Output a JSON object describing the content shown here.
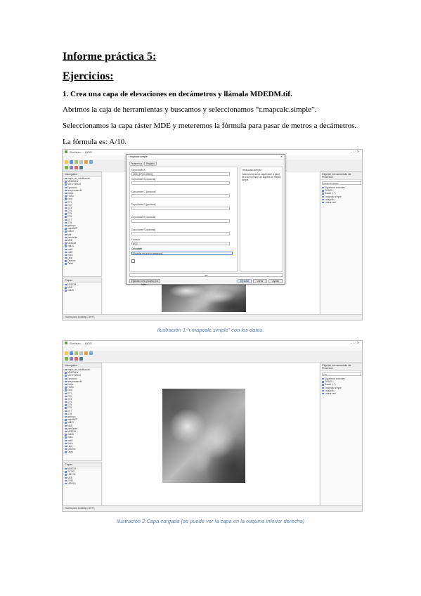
{
  "heading1": "Informe práctica 5:",
  "heading2": "Ejercicios:",
  "question": "1.   Crea una capa de elevaciones en decámetros y llámala MDEDM.tif.",
  "para1": "Abrimos la caja de herramientas y buscamos y seleccionamos “r.mapcalc.simple”.",
  "para2": "Seleccionamos la capa ráster MDE y meteremos la fórmula para pasar de metros a decámetros.",
  "para3": "La fórmula es: A/10.",
  "caption1": "Ilustración 1:“r.mapcalc.simple” con los datos.",
  "caption2": "Ilustración 2:Capa cargada (se puede ver la capa en la esquina inferior derecha)",
  "shot1": {
    "title": "Sin título — QGIS",
    "browser_title": "Navegador",
    "layers_title": "Capas",
    "toolbox_title": "Caja de herramientas de Procesos",
    "browser_items": [
      "mapa_de_clasificación",
      "MDEDM.tif",
      "MDT2.00B.tif",
      "Ejecución",
      "temperatura.tif",
      "Datos",
      "FGBD",
      "zona",
      "GT1",
      "GT2",
      "GT3",
      "GT4",
      "GT5",
      "GT6",
      "GT7",
      "GT8",
      "geotopo",
      "mapaMDT",
      "Mdt23",
      "Mdt",
      "pendiente",
      "MDE",
      "MDEDM",
      "mdt25",
      "mdt6",
      "mdt8",
      "Hidro",
      "Lidar",
      "Ortofoto",
      "Tarea"
    ],
    "layer_items": [
      "MDEDM",
      "MDE",
      "mdt25"
    ],
    "toolbox_items": [
      "r.mapcalc.simple",
      "Algoritmos recientes",
      "GRASS",
      "Raster (r.*)",
      "r.mapcalc.simple",
      "r.mapcalc",
      "r.mask.rast"
    ],
    "statusbar": "Escriba para localizar (Ctrl+K)",
    "dialog": {
      "title": "r.mapcalc.simple",
      "tabs": [
        "Parámetros",
        "Registro"
      ],
      "labels": [
        "Capa ráster A",
        "Capa ráster B [opcional]",
        "Capa ráster C [opcional]",
        "Capa ráster D [opcional]",
        "Capa ráster E [opcional]",
        "Capa ráster F [opcional]",
        "Fórmula",
        "Calculado"
      ],
      "selected": "MDE [EPSG:25830]",
      "formula": "A/10",
      "output": "[Guardar en archivo temporal]",
      "help_title": "r.mapcalc.simple",
      "help_text": "Calcula una nueva capa ráster a partir de una expresión de álgebra de mapas simple.",
      "progress": "0%",
      "buttons": [
        "Ejecutar como proceso por lotes...",
        "Ejecutar",
        "Cerrar",
        "Ayuda"
      ]
    }
  },
  "shot2": {
    "title": "Sin título — QGIS",
    "browser_title": "Navegador",
    "layers_title": "Capas",
    "toolbox_title": "Caja de herramientas de Procesos",
    "browser_items": [
      "mapa_de_clasificación",
      "MDEDM.tif",
      "MDT2.00B.tif",
      "Ejecución",
      "temperatura.tif",
      "Datos",
      "FGBD",
      "zona",
      "GT1",
      "GT2",
      "GT3",
      "GT4",
      "GT5",
      "GT6",
      "GT7",
      "GT8",
      "geotopo",
      "mapaMDT",
      "Mdt23",
      "MDE",
      "pendiente",
      "MDEDM",
      "mdt25",
      "mdt6",
      "mdt8",
      "Hidro",
      "Lidar",
      "Ortofoto",
      "Tarea"
    ],
    "layer_items": [
      "MDEDM",
      "24.789",
      "1560.96",
      "MDE",
      "2.890",
      "15609.6"
    ],
    "toolbox_items": [
      "calc",
      "Algoritmos recientes",
      "GRASS",
      "Raster (r.*)",
      "r.mapcalc.simple",
      "r.mapcalc",
      "r.mask.rast"
    ],
    "statusbar": "Escriba para localizar (Ctrl+K)"
  }
}
